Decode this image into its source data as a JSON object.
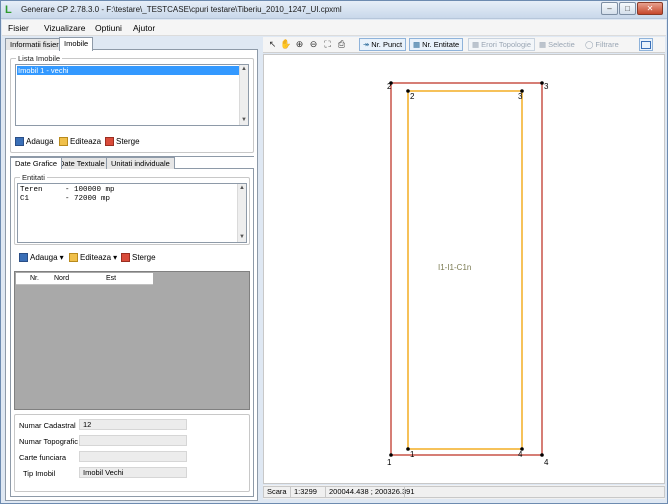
{
  "window": {
    "title": "Generare CP 2.78.3.0 - F:\\testare\\_TESTCASE\\cpuri testare\\Tiberiu_2010_1247_UI.cpxml",
    "app_icon_glyph": "L",
    "controls": [
      "minimize-icon",
      "maximize-icon",
      "close-icon"
    ]
  },
  "menu": [
    "Fisier",
    "Vizualizare",
    "Optiuni",
    "Ajutor"
  ],
  "left_tabs": [
    "Informatii fisier",
    "Imobile"
  ],
  "lista_imobile": {
    "title": "Lista Imobile",
    "items": [
      "Imobil 1 - vechi"
    ],
    "buttons": [
      "Adauga",
      "Editeaza",
      "Sterge"
    ]
  },
  "inner_tabs": [
    "Date Grafice",
    "Date Textuale",
    "Unitati individuale"
  ],
  "entitati": {
    "title": "Entitati",
    "lines": [
      "Teren     - 100000 mp",
      "C1        - 72000 mp"
    ],
    "buttons": [
      "Adauga",
      "Editeaza",
      "Sterge"
    ]
  },
  "coord_table": {
    "columns": [
      "Nr.",
      "Nord",
      "Est"
    ]
  },
  "fields": [
    {
      "label": "Numar Cadastral",
      "value": "12"
    },
    {
      "label": "Numar Topografic",
      "value": ""
    },
    {
      "label": "Carte funciara",
      "value": ""
    },
    {
      "label": "Tip Imobil",
      "value": "Imobil Vechi"
    }
  ],
  "map_toolbar": {
    "tools": [
      "cursor-icon",
      "pan-hand-icon",
      "zoom-in-icon",
      "zoom-out-icon",
      "zoom-extent-icon",
      "print-icon"
    ],
    "buttons": [
      {
        "label": "Nr. Punct",
        "enabled": true
      },
      {
        "label": "Nr. Entitate",
        "enabled": true
      },
      {
        "label": "Erori Topologie",
        "enabled": false
      },
      {
        "label": "Selectie",
        "enabled": false
      },
      {
        "label": "Filtrare",
        "enabled": false
      }
    ]
  },
  "map": {
    "outer_color": "#c0392b",
    "inner_color": "#f0a000",
    "outer_points": [
      "1",
      "2",
      "3",
      "4"
    ],
    "inner_points": [
      "1",
      "2",
      "3",
      "4"
    ],
    "center_label": "I1-I1-C1n"
  },
  "status": {
    "scale_label": "Scara",
    "scale_value": "1:3299",
    "coords": "200044.438 ; 200326.391"
  }
}
